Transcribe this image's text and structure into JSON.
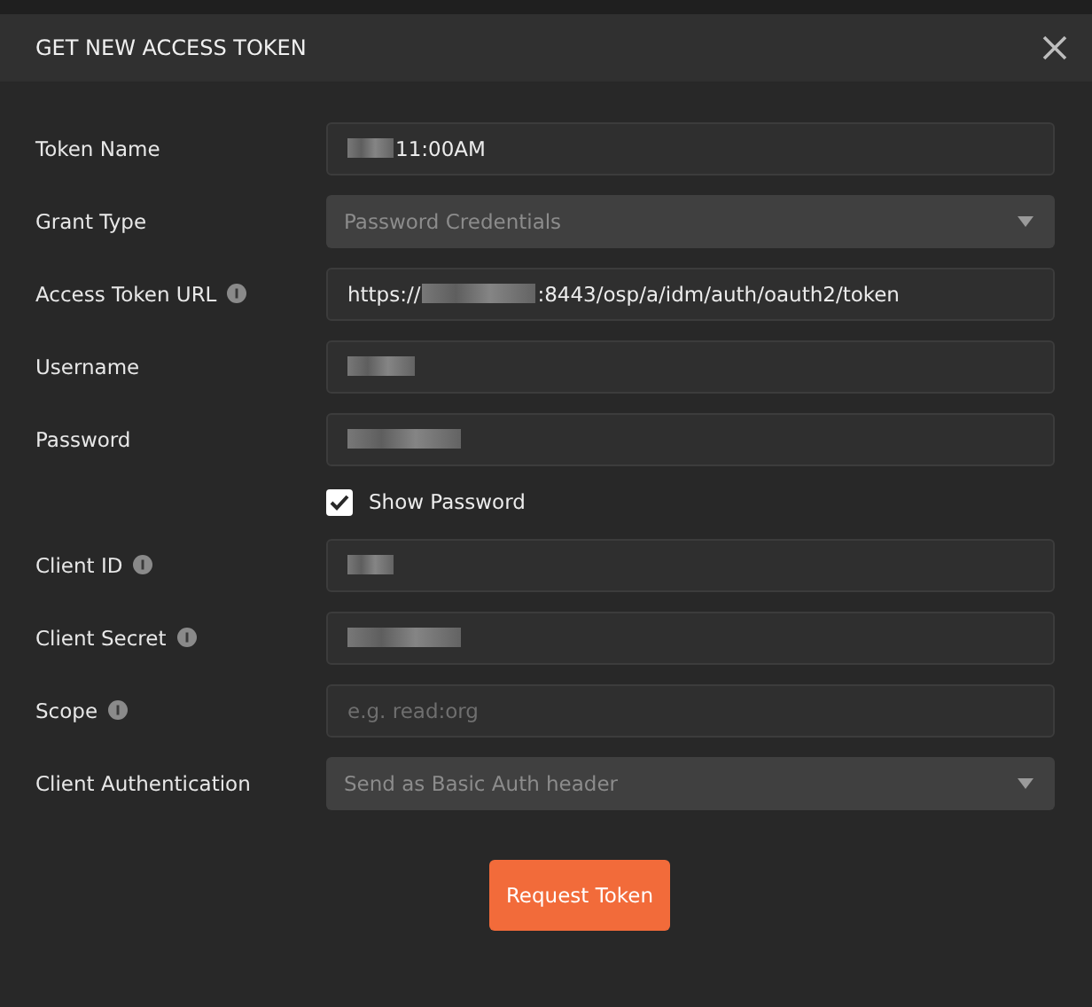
{
  "dialog": {
    "title": "GET NEW ACCESS TOKEN"
  },
  "rows": [
    {
      "kind": "input",
      "label": "Token Name",
      "info": false,
      "value": [
        {
          "kind": "redacted_short"
        },
        {
          "kind": "text",
          "text": "11:00AM"
        }
      ]
    },
    {
      "kind": "select",
      "label": "Grant Type",
      "info": false,
      "value": "Password Credentials"
    },
    {
      "kind": "input",
      "label": "Access Token URL",
      "info": true,
      "value": [
        {
          "kind": "text",
          "text": "https://"
        },
        {
          "kind": "redacted_long"
        },
        {
          "kind": "text",
          "text": ":8443/osp/a/idm/auth/oauth2/token"
        }
      ]
    },
    {
      "kind": "input",
      "label": "Username",
      "info": false,
      "value": [
        {
          "kind": "redacted_medium"
        }
      ]
    },
    {
      "kind": "input",
      "label": "Password",
      "info": false,
      "value": [
        {
          "kind": "redacted_long"
        }
      ]
    },
    {
      "kind": "checkbox",
      "text": "Show Password",
      "checked": true
    },
    {
      "kind": "input",
      "label": "Client ID",
      "info": true,
      "value": [
        {
          "kind": "redacted_short"
        }
      ]
    },
    {
      "kind": "input",
      "label": "Client Secret",
      "info": true,
      "value": [
        {
          "kind": "redacted_long"
        }
      ]
    },
    {
      "kind": "input",
      "label": "Scope",
      "info": true,
      "placeholder": "e.g. read:org",
      "value": []
    },
    {
      "kind": "select",
      "label": "Client Authentication",
      "info": false,
      "value": "Send as Basic Auth header"
    }
  ],
  "button": "Request Token"
}
